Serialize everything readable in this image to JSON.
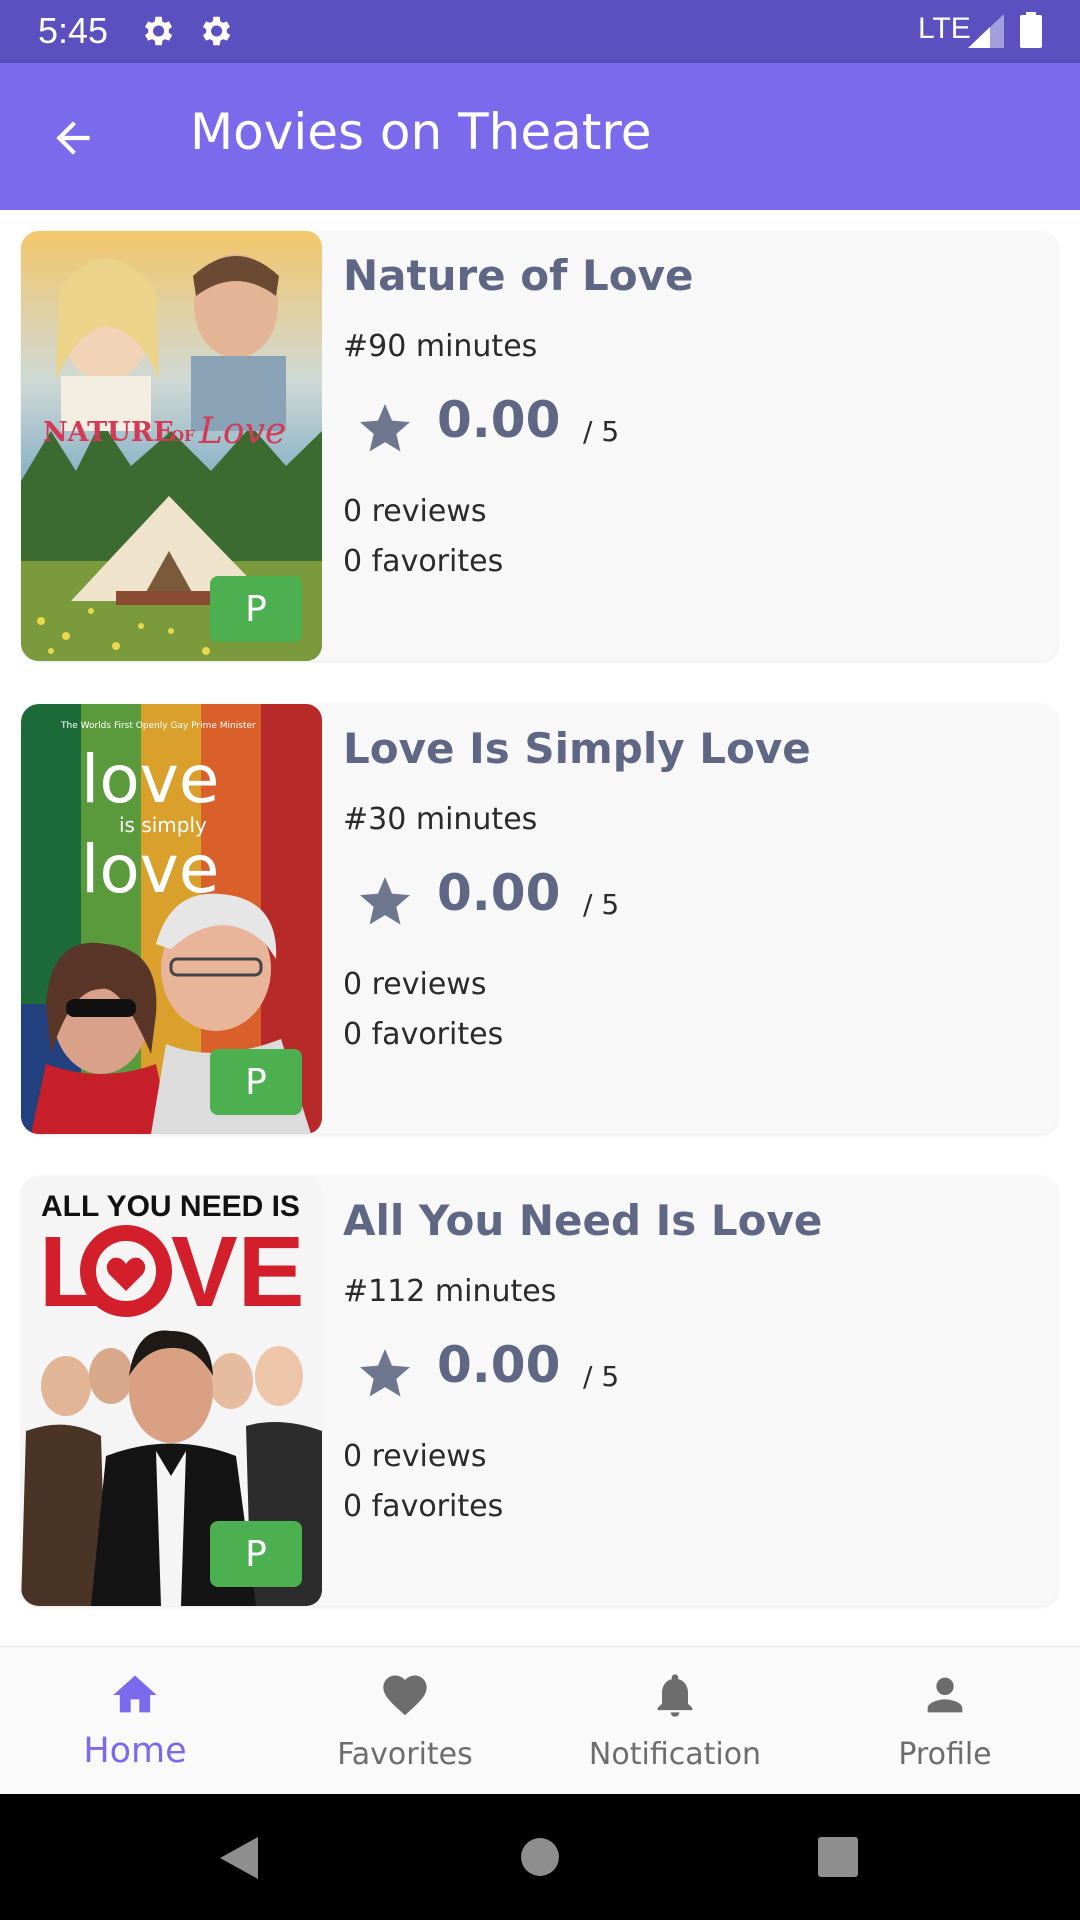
{
  "status_bar": {
    "time": "5:45",
    "network": "LTE",
    "icons": [
      "settings-gear-icon",
      "settings-gear-icon",
      "signal-icon",
      "battery-icon"
    ]
  },
  "app_bar": {
    "title": "Movies on Theatre",
    "back_icon": "arrow-back-icon"
  },
  "movies": [
    {
      "title": "Nature of Love",
      "duration": "#90 minutes",
      "rating": "0.00",
      "rating_max": "/ 5",
      "reviews": "0 reviews",
      "favorites": "0 favorites",
      "badge": "P",
      "poster_text": "NATURE OF Love"
    },
    {
      "title": "Love Is Simply Love",
      "duration": "#30 minutes",
      "rating": "0.00",
      "rating_max": "/ 5",
      "reviews": "0 reviews",
      "favorites": "0 favorites",
      "badge": "P",
      "poster_tagline": "The Worlds First Openly Gay Prime Minister",
      "poster_text_1": "love",
      "poster_text_2": "is simply",
      "poster_text_3": "love"
    },
    {
      "title": "All You Need Is Love",
      "duration": "#112 minutes",
      "rating": "0.00",
      "rating_max": "/ 5",
      "reviews": "0 reviews",
      "favorites": "0 favorites",
      "badge": "P",
      "poster_text_1": "ALL YOU NEED IS",
      "poster_text_2": "L",
      "poster_text_3": "VE"
    }
  ],
  "bottom_nav": {
    "items": [
      {
        "label": "Home",
        "icon": "home-icon",
        "active": true
      },
      {
        "label": "Favorites",
        "icon": "heart-icon",
        "active": false
      },
      {
        "label": "Notification",
        "icon": "bell-icon",
        "active": false
      },
      {
        "label": "Profile",
        "icon": "person-icon",
        "active": false
      }
    ]
  },
  "colors": {
    "status_bar": "#5c4fbf",
    "app_bar": "#7b6aeb",
    "accent": "#7b6aeb",
    "title_text": "#5f6785",
    "badge": "#4caf50",
    "card_bg": "#f8f8f8"
  }
}
